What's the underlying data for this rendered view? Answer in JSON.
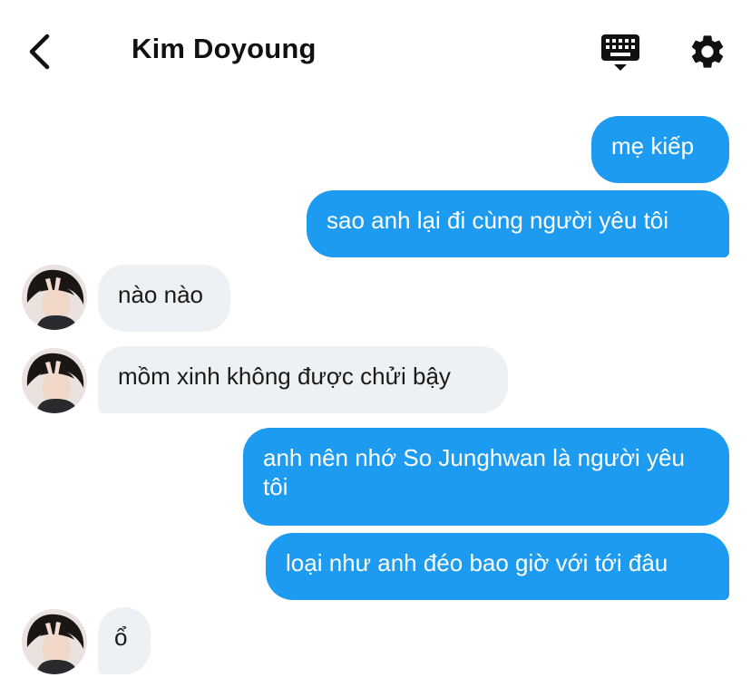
{
  "header": {
    "title": "Kim Doyoung",
    "back_icon": "chevron-left-icon",
    "keyboard_icon": "keyboard-icon",
    "settings_icon": "gear-icon"
  },
  "colors": {
    "outgoing_bubble": "#1d9bf0",
    "incoming_bubble": "#eef1f4"
  },
  "messages": [
    {
      "from": "me",
      "text": "mẹ kiếp"
    },
    {
      "from": "me",
      "text": "sao anh lại đi cùng người yêu tôi"
    },
    {
      "from": "them",
      "text": "nào nào"
    },
    {
      "from": "them",
      "text": "mồm xinh không được chửi bậy"
    },
    {
      "from": "me",
      "text": "anh nên nhớ So Junghwan là người yêu tôi"
    },
    {
      "from": "me",
      "text": "loại như anh đéo bao giờ với tới đâu"
    },
    {
      "from": "them",
      "text": "ổ"
    }
  ]
}
